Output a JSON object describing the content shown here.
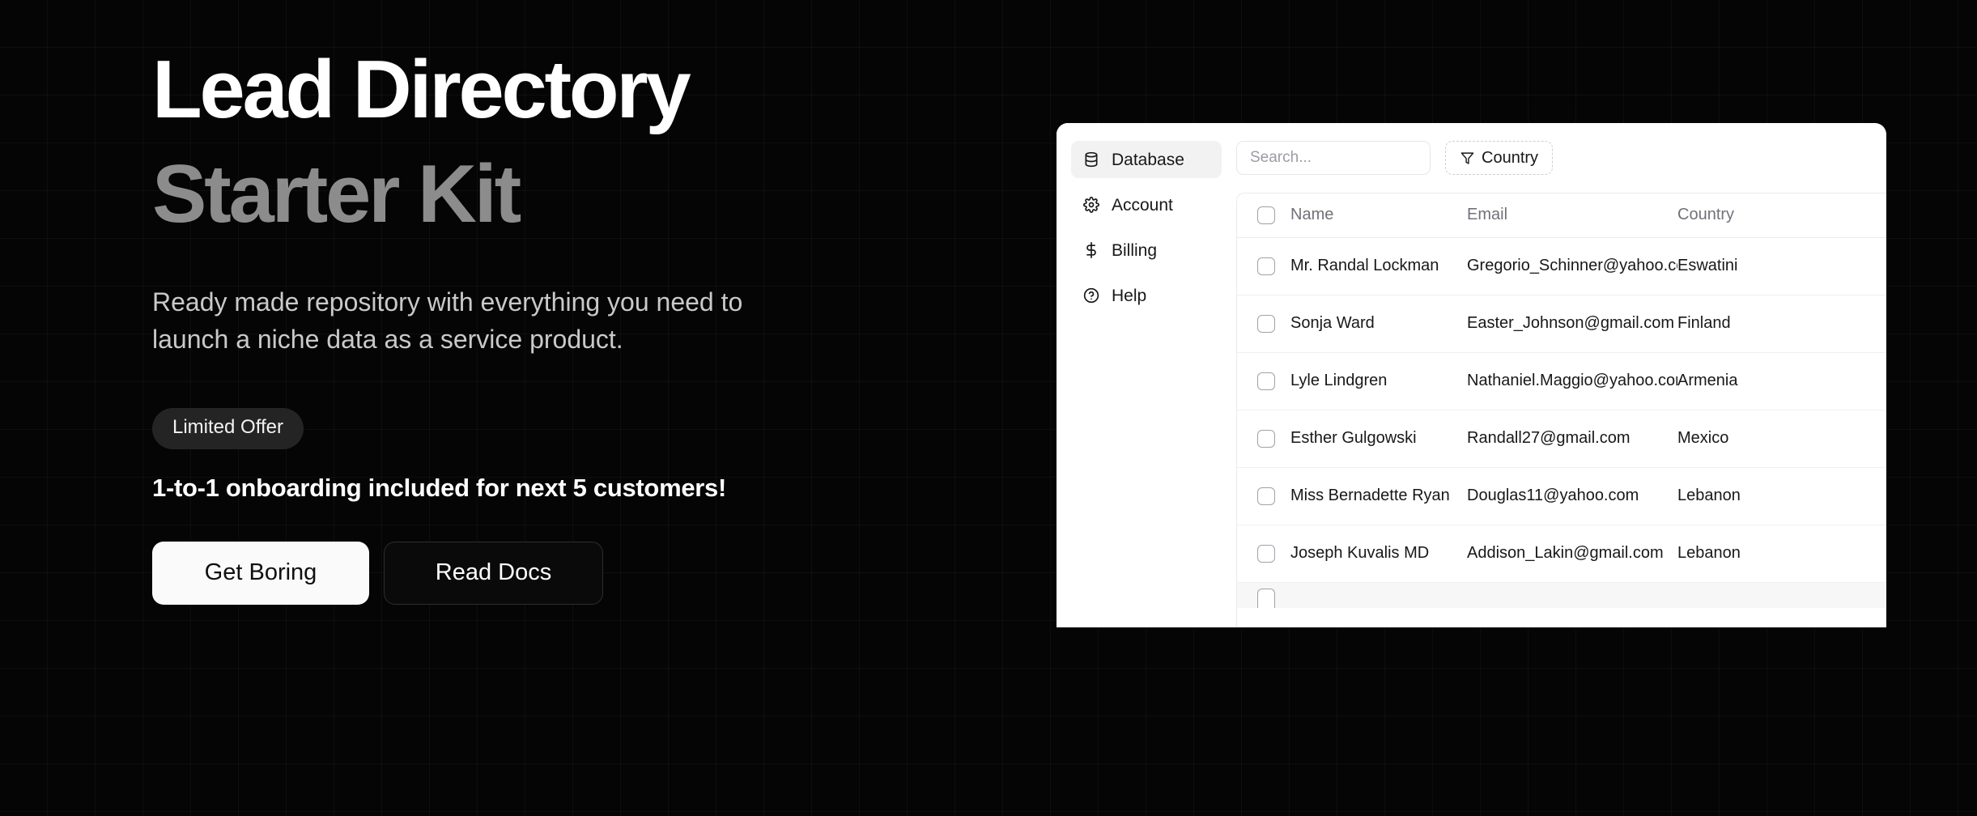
{
  "hero": {
    "headline_line1": "Lead Directory",
    "headline_line2": "Starter Kit",
    "subtitle": "Ready made repository with everything you need to launch a niche data as a service product.",
    "badge": "Limited Offer",
    "offer": "1-to-1 onboarding included for next 5 customers!",
    "primary_button": "Get Boring",
    "secondary_button": "Read Docs",
    "colors": {
      "background": "#050505",
      "headline_primary": "#ffffff",
      "headline_secondary": "#8c8c8c",
      "subtitle": "#c9c9c9",
      "badge_bg": "#242424",
      "primary_button_bg": "#fafafa",
      "secondary_button_border": "#2e2e2e"
    }
  },
  "app": {
    "sidebar": {
      "items": [
        {
          "label": "Database",
          "icon": "database-icon",
          "active": true
        },
        {
          "label": "Account",
          "icon": "gear-icon",
          "active": false
        },
        {
          "label": "Billing",
          "icon": "dollar-icon",
          "active": false
        },
        {
          "label": "Help",
          "icon": "question-circle-icon",
          "active": false
        }
      ]
    },
    "toolbar": {
      "search_placeholder": "Search...",
      "search_value": "",
      "filter_label": "Country",
      "filter_icon": "funnel-icon"
    },
    "table": {
      "columns": [
        "Name",
        "Email",
        "Country"
      ],
      "select_all_checked": false,
      "rows": [
        {
          "name": "Mr. Randal Lockman",
          "email": "Gregorio_Schinner@yahoo.com",
          "country": "Eswatini",
          "checked": false
        },
        {
          "name": "Sonja Ward",
          "email": "Easter_Johnson@gmail.com",
          "country": "Finland",
          "checked": false
        },
        {
          "name": "Lyle Lindgren",
          "email": "Nathaniel.Maggio@yahoo.com",
          "country": "Armenia",
          "checked": false
        },
        {
          "name": "Esther Gulgowski",
          "email": "Randall27@gmail.com",
          "country": "Mexico",
          "checked": false
        },
        {
          "name": "Miss Bernadette Ryan",
          "email": "Douglas11@yahoo.com",
          "country": "Lebanon",
          "checked": false
        },
        {
          "name": "Joseph Kuvalis MD",
          "email": "Addison_Lakin@gmail.com",
          "country": "Lebanon",
          "checked": false
        }
      ]
    },
    "colors": {
      "panel_bg": "#ffffff",
      "active_nav_bg": "#f2f2f3",
      "header_text": "#71717a",
      "row_text": "#18181b",
      "border": "#ebebee"
    }
  }
}
